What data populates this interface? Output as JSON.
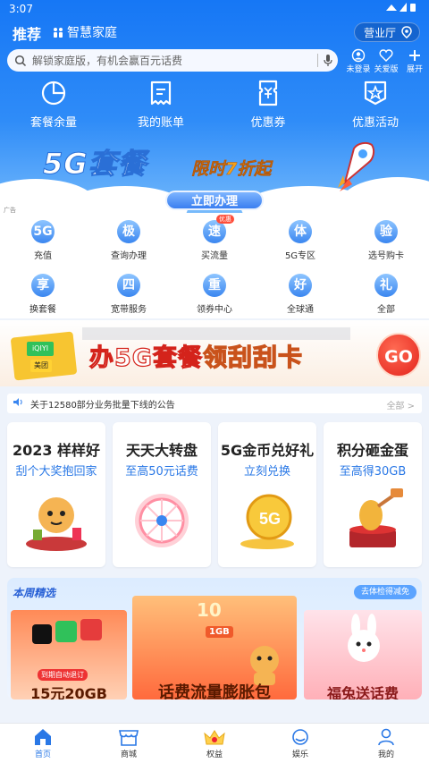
{
  "status": {
    "time": "3:07"
  },
  "header": {
    "tab_recommend": "推荐",
    "tab_home": "智慧家庭",
    "shop_button": "营业厅",
    "search_placeholder": "解锁家庭版，有机会赢百元话费",
    "icons": [
      {
        "label": "未登录",
        "icon": "login-icon"
      },
      {
        "label": "关爱版",
        "icon": "heart-icon"
      },
      {
        "label": "展开",
        "icon": "plus-icon"
      }
    ]
  },
  "quick": [
    {
      "label": "套餐余量",
      "icon": "pie-chart-icon"
    },
    {
      "label": "我的账单",
      "icon": "bill-icon"
    },
    {
      "label": "优惠券",
      "icon": "coupon-icon"
    },
    {
      "label": "优惠活动",
      "icon": "star-badge-icon"
    }
  ],
  "banner_5g": {
    "title": "5G套餐",
    "subtitle": "限时7折起",
    "button": "立即办理",
    "ad_tag": "广告"
  },
  "services": [
    {
      "glyph": "5G",
      "label": "充值"
    },
    {
      "glyph": "极",
      "label": "查询办理"
    },
    {
      "glyph": "速",
      "label": "买流量",
      "badge": "优惠"
    },
    {
      "glyph": "体",
      "label": "5G专区"
    },
    {
      "glyph": "验",
      "label": "选号购卡"
    },
    {
      "glyph": "享",
      "label": "换套餐"
    },
    {
      "glyph": "四",
      "label": "宽带服务"
    },
    {
      "glyph": "重",
      "label": "领券中心"
    },
    {
      "glyph": "好",
      "label": "全球通"
    },
    {
      "glyph": "礼",
      "label": "全部"
    }
  ],
  "banner_go": {
    "text_a": "办5G套餐",
    "text_b": "领刮刮卡",
    "go": "GO",
    "brand1": "美团",
    "brand2": "iQIYI"
  },
  "notice": {
    "text": "关于12580部分业务批量下线的公告",
    "more": "全部 >"
  },
  "cards": [
    {
      "title": "2023 样样好",
      "subtitle": "刮个大奖抱回家"
    },
    {
      "title": "天天大转盘",
      "subtitle": "至高50元话费"
    },
    {
      "title": "5G金币兑好礼",
      "subtitle": "立刻兑换"
    },
    {
      "title": "积分砸金蛋",
      "subtitle": "至高得30GB"
    }
  ],
  "weekly": {
    "title": "本周精选",
    "pill": "去体检得减免",
    "promos": [
      {
        "caption": "15元20GB",
        "tag": "到期自动退订"
      },
      {
        "caption": "话费流量膨胀包",
        "tag": "1GB",
        "amount": "10"
      },
      {
        "caption": "福兔送话费"
      }
    ]
  },
  "tabs": [
    {
      "label": "首页",
      "icon": "home-icon"
    },
    {
      "label": "商城",
      "icon": "shop-icon"
    },
    {
      "label": "权益",
      "icon": "crown-icon"
    },
    {
      "label": "娱乐",
      "icon": "play-icon"
    },
    {
      "label": "我的",
      "icon": "user-icon"
    }
  ],
  "colors": {
    "brand": "#1677f5",
    "accent": "#2a78e6",
    "hot": "#e3231c"
  }
}
